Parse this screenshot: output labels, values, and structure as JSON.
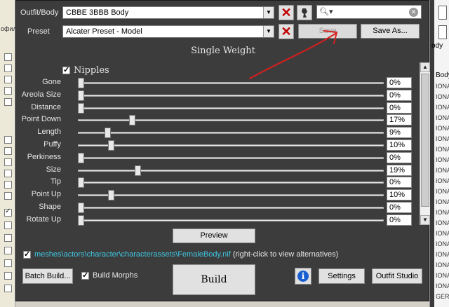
{
  "background_app": {
    "left_label": "офил",
    "right_header": "ody",
    "right_header2": "BodyS",
    "right_rows": [
      "IONA,",
      "IONA,",
      "IONA,",
      "IONA,",
      "IONA,",
      "IONA,",
      "IONA,",
      "IONA,",
      "IONA,",
      "IONA,",
      "IONA,",
      "IONA,",
      "IONA,",
      "IONA,",
      "IONA,",
      "IONA,",
      "IONA,",
      "IONA,",
      "IONA,",
      "IONA,",
      "GERMIONA,"
    ]
  },
  "dialog": {
    "outfit_label": "Outfit/Body",
    "outfit_value": "CBBE 3BBB Body",
    "preset_label": "Preset",
    "preset_value": "Alcater Preset - Model",
    "save_label": "Save",
    "save_as_label": "Save As...",
    "search_value": "",
    "weight_title": "Single Weight",
    "group_label": "Nipples",
    "group_checked": true,
    "sliders": [
      {
        "name": "Gone",
        "value": 0,
        "display": "0%"
      },
      {
        "name": "Areola Size",
        "value": 0,
        "display": "0%"
      },
      {
        "name": "Distance",
        "value": 0,
        "display": "0%"
      },
      {
        "name": "Point Down",
        "value": 17,
        "display": "17%"
      },
      {
        "name": "Length",
        "value": 9,
        "display": "9%"
      },
      {
        "name": "Puffy",
        "value": 10,
        "display": "10%"
      },
      {
        "name": "Perkiness",
        "value": 0,
        "display": "0%"
      },
      {
        "name": "Size",
        "value": 19,
        "display": "19%"
      },
      {
        "name": "Tip",
        "value": 0,
        "display": "0%"
      },
      {
        "name": "Point Up",
        "value": 10,
        "display": "10%"
      },
      {
        "name": "Shape",
        "value": 0,
        "display": "0%"
      },
      {
        "name": "Rotate Up",
        "value": 0,
        "display": "0%"
      }
    ],
    "preview_label": "Preview",
    "mesh_path": "meshes\\actors\\character\\characterassets\\FemaleBody.nif",
    "mesh_hint": "(right-click to view alternatives)",
    "batch_build_label": "Batch Build...",
    "build_morphs_label": "Build Morphs",
    "build_label": "Build",
    "settings_label": "Settings",
    "outfit_studio_label": "Outfit Studio"
  },
  "colors": {
    "dialog_bg": "#3c3c3c",
    "link": "#3ec6e0",
    "annotation": "#d81e1e",
    "delete": "#c00000",
    "info": "#1a5fd1"
  }
}
